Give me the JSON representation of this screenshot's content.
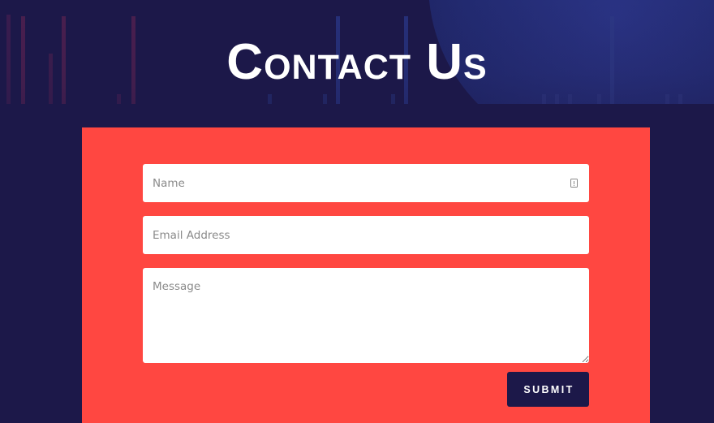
{
  "header": {
    "title": "Contact Us"
  },
  "form": {
    "name_placeholder": "Name",
    "email_placeholder": "Email Address",
    "message_placeholder": "Message",
    "submit_label": "Submit"
  },
  "icons": {
    "autofill": "contact-card-icon"
  },
  "colors": {
    "background": "#1c1849",
    "card": "#ff4741",
    "button": "#1c1849",
    "button_text": "#ffffff",
    "title_text": "#ffffff"
  }
}
